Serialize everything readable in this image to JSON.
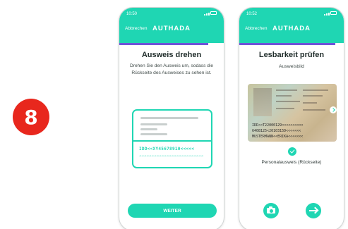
{
  "step": {
    "number": "8"
  },
  "colors": {
    "accent": "#1fd6b3",
    "progress": "#6f55d8",
    "badge": "#e8271d"
  },
  "screen1": {
    "status_time": "10:50",
    "cancel_label": "Abbrechen",
    "brand": "AUTHADA",
    "progress": 0.85,
    "title": "Ausweis drehen",
    "description": "Drehen Sie den Ausweis um, sodass die Rückseite des Ausweises zu sehen ist.",
    "card": {
      "mrz_line1": "IDD<<XY45678910<<<<<",
      "mrz_line2": "<<<<<<<<<<<<<<<<<<<<<<<<<<"
    },
    "next_button": "WEITER"
  },
  "screen2": {
    "status_time": "10:52",
    "cancel_label": "Abbrechen",
    "brand": "AUTHADA",
    "progress": 0.92,
    "title": "Lesbarkeit prüfen",
    "subtitle": "Ausweisbild",
    "scan_mrz": [
      "IDD<<T22000129<<<<<<<<<<",
      "6408125<2010315D<<<<<<<",
      "MUSTERMANN<<ERIKA<<<<<<<"
    ],
    "document_label": "Personalausweis (Rückseite)",
    "icons": {
      "retake": "camera-icon",
      "continue": "arrow-right-icon",
      "verified": "check-icon"
    }
  }
}
